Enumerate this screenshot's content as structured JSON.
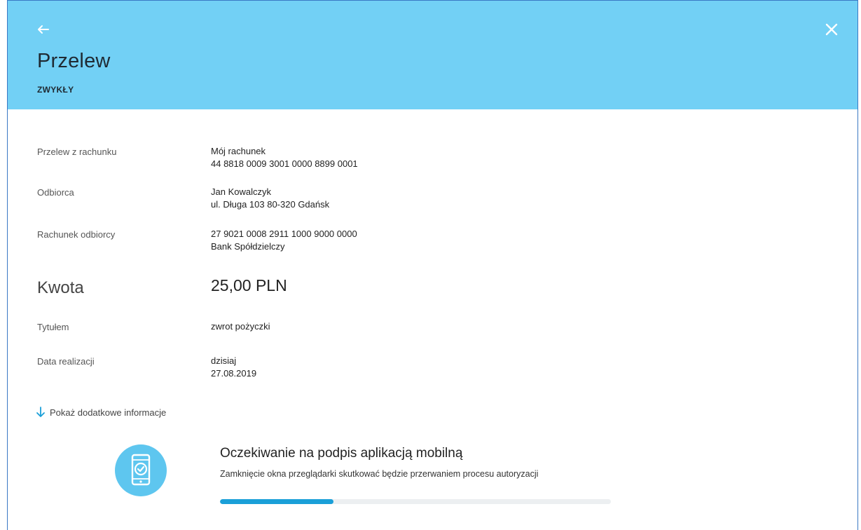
{
  "header": {
    "title": "Przelew",
    "subtitle": "ZWYKŁY",
    "back_icon": "arrow-left-icon",
    "close_icon": "close-icon",
    "background_color": "#72d0f5"
  },
  "details": {
    "from_account": {
      "label": "Przelew z rachunku",
      "name": "Mój rachunek",
      "number": "44 8818 0009 3001 0000 8899 0001"
    },
    "recipient": {
      "label": "Odbiorca",
      "name": "Jan Kowalczyk",
      "address": "ul. Długa 103 80-320 Gdańsk"
    },
    "recipient_account": {
      "label": "Rachunek odbiorcy",
      "number": "27 9021 0008 2911 1000 9000 0000",
      "bank": "Bank Spółdzielczy"
    },
    "amount": {
      "label": "Kwota",
      "value": "25,00 PLN"
    },
    "title": {
      "label": "Tytułem",
      "value": "zwrot pożyczki"
    },
    "date": {
      "label": "Data realizacji",
      "day": "dzisiaj",
      "value": "27.08.2019"
    }
  },
  "more_info": {
    "label": "Pokaż dodatkowe informacje",
    "icon": "arrow-down-icon"
  },
  "authorization": {
    "icon": "phone-check-icon",
    "title": "Oczekiwanie na podpis aplikacją mobilną",
    "description": "Zamknięcie okna przeglądarki skutkować będzie przerwaniem procesu autoryzacji",
    "progress_percent": 29
  },
  "colors": {
    "accent": "#1a9fd8",
    "icon_circle": "#5ec6ef"
  }
}
